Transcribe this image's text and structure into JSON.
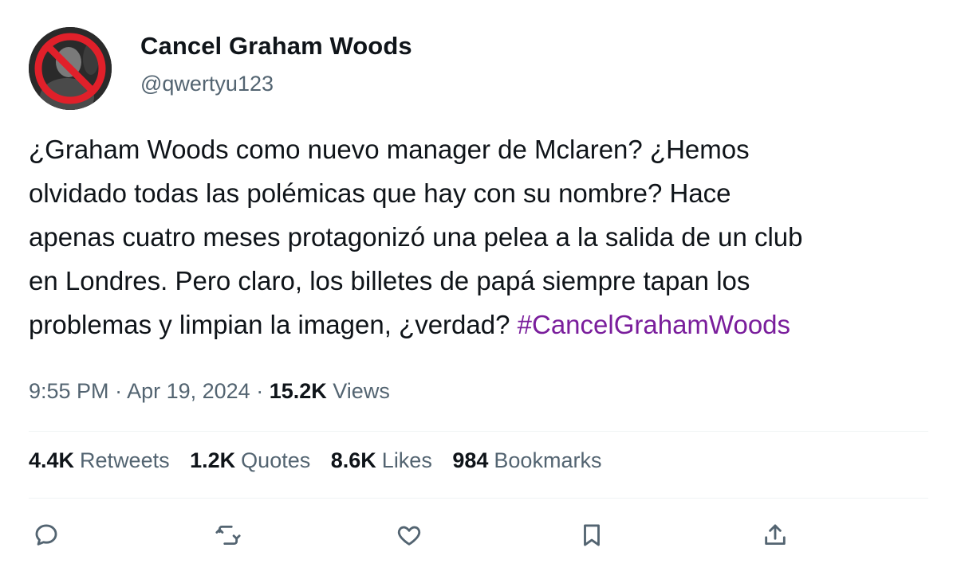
{
  "author": {
    "display_name": "Cancel Graham Woods",
    "handle": "@qwertyu123",
    "avatar_icon": "no-symbol-over-photo-icon"
  },
  "tweet": {
    "lines": [
      "¿Graham Woods como nuevo manager de Mclaren? ¿Hemos",
      "olvidado todas las polémicas que hay con su nombre? Hace",
      "apenas cuatro meses protagonizó una pelea a la salida de un club",
      "en Londres. Pero claro, los billetes de papá siempre tapan los",
      "problemas y limpian la imagen, ¿verdad? "
    ],
    "hashtag": "#CancelGrahamWoods"
  },
  "meta": {
    "time": "9:55 PM",
    "separator1": " · ",
    "date": "Apr 19, 2024",
    "separator2": " · ",
    "views_count": "15.2K",
    "views_label": "Views"
  },
  "stats": {
    "retweets_count": "4.4K",
    "retweets_label": "Retweets",
    "quotes_count": "1.2K",
    "quotes_label": "Quotes",
    "likes_count": "8.6K",
    "likes_label": "Likes",
    "bookmarks_count": "984",
    "bookmarks_label": "Bookmarks"
  },
  "actions": [
    {
      "icon": "reply-icon"
    },
    {
      "icon": "retweet-icon"
    },
    {
      "icon": "like-icon"
    },
    {
      "icon": "bookmark-icon"
    },
    {
      "icon": "share-icon"
    }
  ],
  "colors": {
    "text": "#0f1419",
    "secondary": "#536471",
    "hashtag": "#7a1e9c",
    "no_symbol": "#e0202a"
  }
}
